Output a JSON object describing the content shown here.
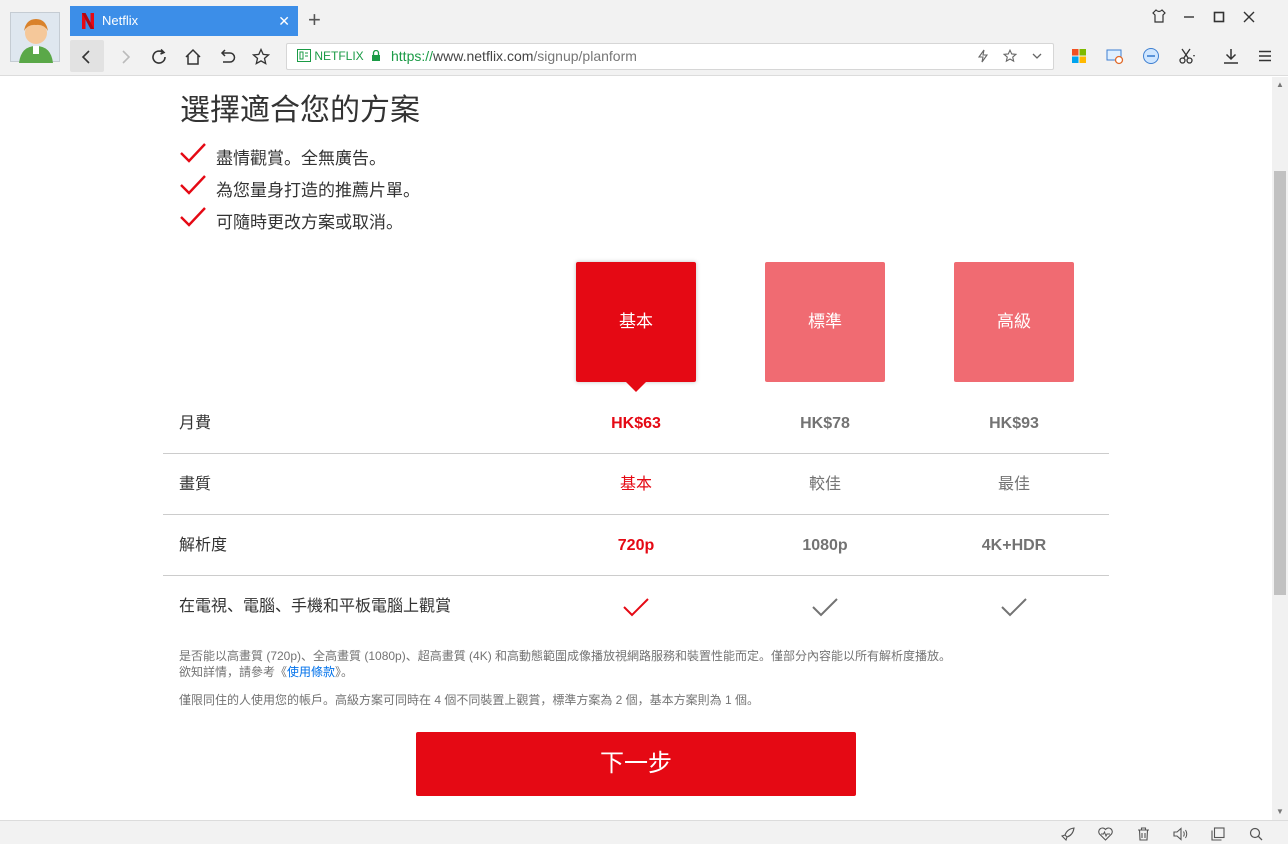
{
  "browser": {
    "tab_title": "Netflix",
    "tab_close": "✕",
    "new_tab": "+",
    "site_label": "NETFLIX",
    "url_protocol": "https://",
    "url_host": "www.netflix.com",
    "url_path": "/signup/planform"
  },
  "page": {
    "heading": "選擇適合您的方案",
    "benefits": [
      "盡情觀賞。全無廣告。",
      "為您量身打造的推薦片單。",
      "可隨時更改方案或取消。"
    ],
    "plans": [
      {
        "name": "基本",
        "selected": true
      },
      {
        "name": "標準",
        "selected": false
      },
      {
        "name": "高級",
        "selected": false
      }
    ],
    "rows": [
      {
        "label": "月費",
        "values": [
          "HK$63",
          "HK$78",
          "HK$93"
        ]
      },
      {
        "label": "畫質",
        "values": [
          "基本",
          "較佳",
          "最佳"
        ]
      },
      {
        "label": "解析度",
        "values": [
          "720p",
          "1080p",
          "4K+HDR"
        ]
      },
      {
        "label": "在電視、電腦、手機和平板電腦上觀賞"
      }
    ],
    "note1_text": "是否能以高畫質 (720p)、全高畫質 (1080p)、超高畫質 (4K) 和高動態範圍成像播放視網路服務和裝置性能而定。僅部分內容能以所有解析度播放。欲知詳情，請參考《",
    "note1_link": "使用條款",
    "note1_end": "》。",
    "note2": "僅限同住的人使用您的帳戶。高級方案可同時在 4 個不同裝置上觀賞，標準方案為 2 個，基本方案則為 1 個。",
    "next_button": "下一步"
  },
  "colors": {
    "netflix_red": "#e50914",
    "plan_unselected": "#f06b72",
    "tab_blue": "#3c8ee8"
  }
}
